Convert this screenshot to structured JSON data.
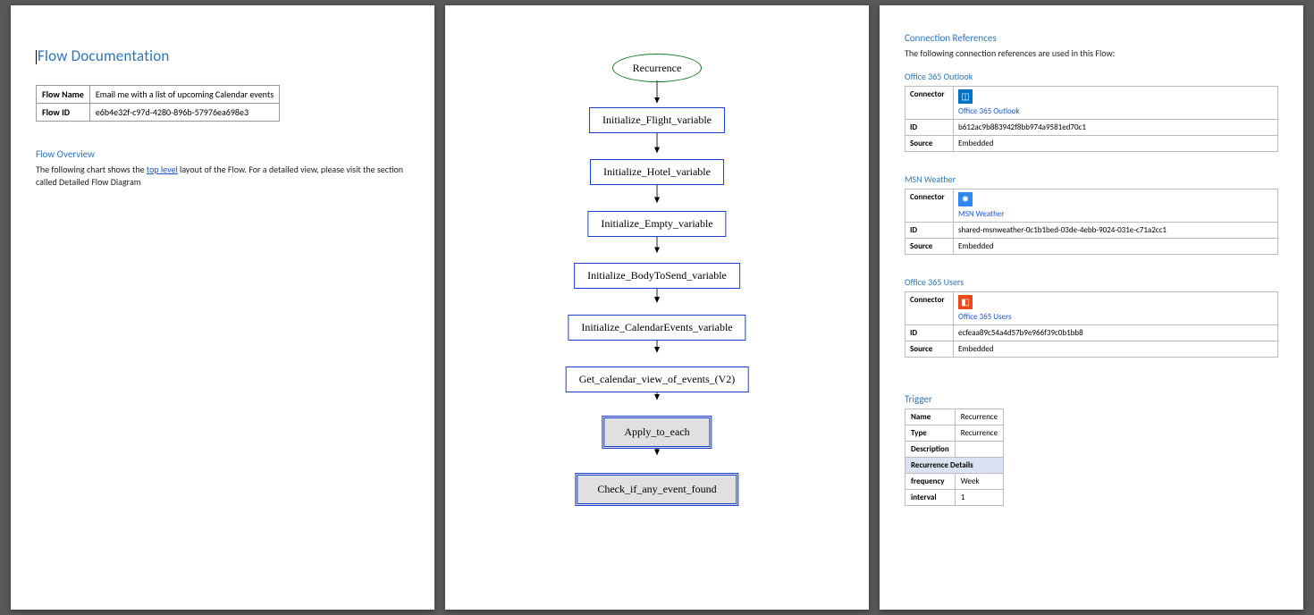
{
  "page1": {
    "title": "Flow Documentation",
    "info": {
      "name_label": "Flow Name",
      "name_value": "Email me with a list of upcoming Calendar events",
      "id_label": "Flow ID",
      "id_value": "e6b4e32f-c97d-4280-896b-57976ea698e3"
    },
    "overview_heading": "Flow Overview",
    "overview_prefix": "The following chart shows the ",
    "overview_link": "top level",
    "overview_suffix": " layout of the Flow. For a detailed view, please visit the section called Detailed Flow Diagram"
  },
  "diagram": {
    "recurrence": "Recurrence",
    "n1": "Initialize_Flight_variable",
    "n2": "Initialize_Hotel_variable",
    "n3": "Initialize_Empty_variable",
    "n4": "Initialize_BodyToSend_variable",
    "n5": "Initialize_CalendarEvents_variable",
    "n6": "Get_calendar_view_of_events_(V2)",
    "n7": "Apply_to_each",
    "n8": "Check_if_any_event_found"
  },
  "page3": {
    "conn_ref_heading": "Connection References",
    "conn_ref_sub": "The following connection references are used in this Flow:",
    "label_connector": "Connector",
    "label_id": "ID",
    "label_source": "Source",
    "embedded": "Embedded",
    "outlook": {
      "heading": "Office 365 Outlook",
      "link": "Office 365 Outlook",
      "id": "b612ac9b883942f8bb974a9581ed70c1"
    },
    "weather": {
      "heading": "MSN Weather",
      "link": "MSN Weather",
      "id": "shared-msnweather-0c1b1bed-03de-4ebb-9024-031e-c71a2cc1"
    },
    "users": {
      "heading": "Office 365 Users",
      "link": "Office 365 Users",
      "id": "ecfeaa89c54a4d57b9e966f39c0b1bb8"
    },
    "trigger_heading": "Trigger",
    "trigger": {
      "name_label": "Name",
      "name_value": "Recurrence",
      "type_label": "Type",
      "type_value": "Recurrence",
      "desc_label": "Description",
      "desc_value": "",
      "details_header": "Recurrence Details",
      "freq_label": "frequency",
      "freq_value": "Week",
      "interval_label": "interval",
      "interval_value": "1"
    }
  }
}
